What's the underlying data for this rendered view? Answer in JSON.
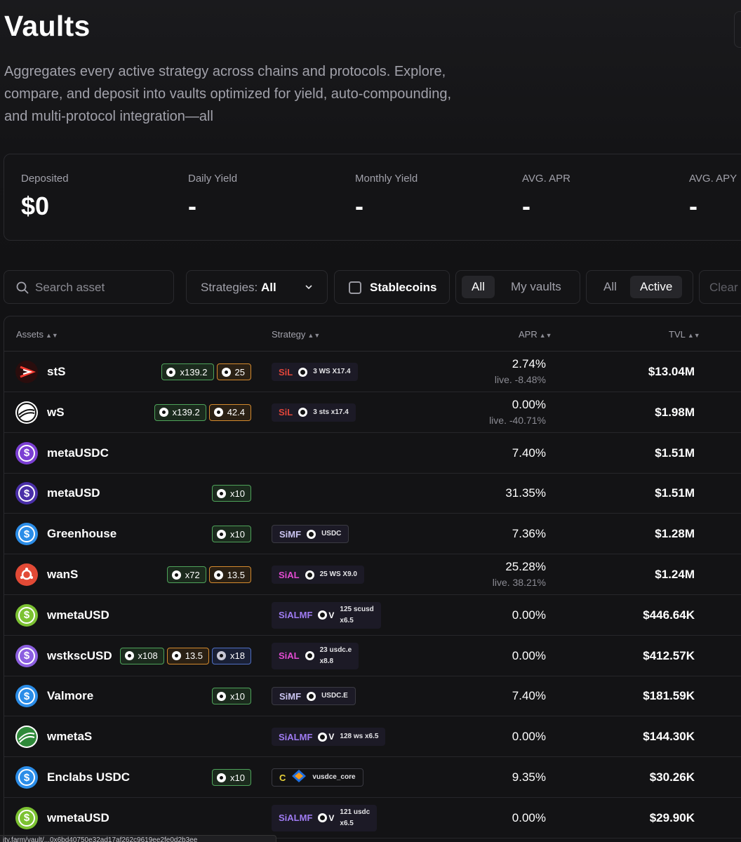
{
  "header": {
    "title": "Vaults",
    "subtitle": "Aggregates every active strategy across chains and protocols. Explore, compare, and deposit into vaults optimized for yield, auto-compounding, and multi-protocol integration—all"
  },
  "stats": [
    {
      "label": "Deposited",
      "value": "$0"
    },
    {
      "label": "Daily Yield",
      "value": "-"
    },
    {
      "label": "Monthly Yield",
      "value": "-"
    },
    {
      "label": "AVG. APR",
      "value": "-"
    },
    {
      "label": "AVG. APY",
      "value": "-"
    }
  ],
  "filters": {
    "search_placeholder": "Search asset",
    "strategies_label": "Strategies:",
    "strategies_value": "All",
    "stablecoins_label": "Stablecoins",
    "scope_all": "All",
    "scope_my": "My vaults",
    "status_all": "All",
    "status_active": "Active",
    "clear": "Clear"
  },
  "table": {
    "columns": {
      "assets": "Assets",
      "strategy": "Strategy",
      "apr": "APR",
      "tvl": "TVL"
    },
    "rows": [
      {
        "name": "stS",
        "logo": "sts-logo",
        "badges": [
          {
            "kind": "g",
            "text": "x139.2"
          },
          {
            "kind": "o",
            "text": "25"
          }
        ],
        "strategy": {
          "tag": "SiL",
          "color": "#e0453a",
          "desc1": "3 WS X17.4",
          "desc2": ""
        },
        "apr": "2.74%",
        "live": "live. -8.48%",
        "tvl": "$13.04M"
      },
      {
        "name": "wS",
        "logo": "ws-logo",
        "badges": [
          {
            "kind": "g",
            "text": "x139.2"
          },
          {
            "kind": "o",
            "text": "42.4"
          }
        ],
        "strategy": {
          "tag": "SiL",
          "color": "#e0453a",
          "desc1": "3 sts x17.4",
          "desc2": ""
        },
        "apr": "0.00%",
        "live": "live. -40.71%",
        "tvl": "$1.98M"
      },
      {
        "name": "metaUSDC",
        "logo": "metausdc-logo",
        "badges": [],
        "strategy": null,
        "apr": "7.40%",
        "live": "",
        "tvl": "$1.51M"
      },
      {
        "name": "metaUSD",
        "logo": "metausd-logo",
        "badges": [
          {
            "kind": "g",
            "text": "x10"
          }
        ],
        "strategy": null,
        "apr": "31.35%",
        "live": "",
        "tvl": "$1.51M"
      },
      {
        "name": "Greenhouse",
        "logo": "greenhouse-logo",
        "badges": [
          {
            "kind": "g",
            "text": "x10"
          }
        ],
        "strategy": {
          "tag": "SiMF",
          "color": "#c9c3f0",
          "desc1": "USDC",
          "desc2": ""
        },
        "apr": "7.36%",
        "live": "",
        "tvl": "$1.28M"
      },
      {
        "name": "wanS",
        "logo": "wans-logo",
        "badges": [
          {
            "kind": "g",
            "text": "x72"
          },
          {
            "kind": "o",
            "text": "13.5"
          }
        ],
        "strategy": {
          "tag": "SiAL",
          "color": "#e24bd2",
          "desc1": "25 WS X9.0",
          "desc2": ""
        },
        "apr": "25.28%",
        "live": "live. 38.21%",
        "tvl": "$1.24M"
      },
      {
        "name": "wmetaUSD",
        "logo": "wmetausd-logo",
        "badges": [],
        "strategy": {
          "tag": "SiALMF",
          "color": "#9f7bf2",
          "desc1": "125 scusd",
          "desc2": "x6.5"
        },
        "apr": "0.00%",
        "live": "",
        "tvl": "$446.64K"
      },
      {
        "name": "wstkscUSD",
        "logo": "wstkscusd-logo",
        "badges": [
          {
            "kind": "g",
            "text": "x108"
          },
          {
            "kind": "o",
            "text": "13.5"
          },
          {
            "kind": "b",
            "text": "x18"
          }
        ],
        "strategy": {
          "tag": "SiAL",
          "color": "#e24bd2",
          "desc1": "23 usdc.e",
          "desc2": "x8.8"
        },
        "apr": "0.00%",
        "live": "",
        "tvl": "$412.57K"
      },
      {
        "name": "Valmore",
        "logo": "valmore-logo",
        "badges": [
          {
            "kind": "g",
            "text": "x10"
          }
        ],
        "strategy": {
          "tag": "SiMF",
          "color": "#c9c3f0",
          "desc1": "USDC.E",
          "desc2": ""
        },
        "apr": "7.40%",
        "live": "",
        "tvl": "$181.59K"
      },
      {
        "name": "wmetaS",
        "logo": "wmetas-logo",
        "badges": [],
        "strategy": {
          "tag": "SiALMF",
          "color": "#9f7bf2",
          "desc1": "128 ws x6.5",
          "desc2": ""
        },
        "apr": "0.00%",
        "live": "",
        "tvl": "$144.30K"
      },
      {
        "name": "Enclabs USDC",
        "logo": "enclabs-logo",
        "badges": [
          {
            "kind": "g",
            "text": "x10"
          }
        ],
        "strategy": {
          "tag": "C",
          "color": "#e8d23a",
          "desc1": "vusdce_core",
          "desc2": ""
        },
        "apr": "9.35%",
        "live": "",
        "tvl": "$30.26K"
      },
      {
        "name": "wmetaUSD",
        "logo": "wmetausd-logo",
        "badges": [],
        "strategy": {
          "tag": "SiALMF",
          "color": "#9f7bf2",
          "desc1": "121 usdc",
          "desc2": "x6.5"
        },
        "apr": "0.00%",
        "live": "",
        "tvl": "$29.90K"
      }
    ]
  },
  "status_bar_url": "ity.farm/vault/...0x6bd40750e32ad17af262c9619ee2fe0d2b3ee",
  "colors": {
    "background": "#121214",
    "badge_green": "#4ea35a",
    "badge_orange": "#d48a2e",
    "badge_blue": "#4f6fc4"
  }
}
